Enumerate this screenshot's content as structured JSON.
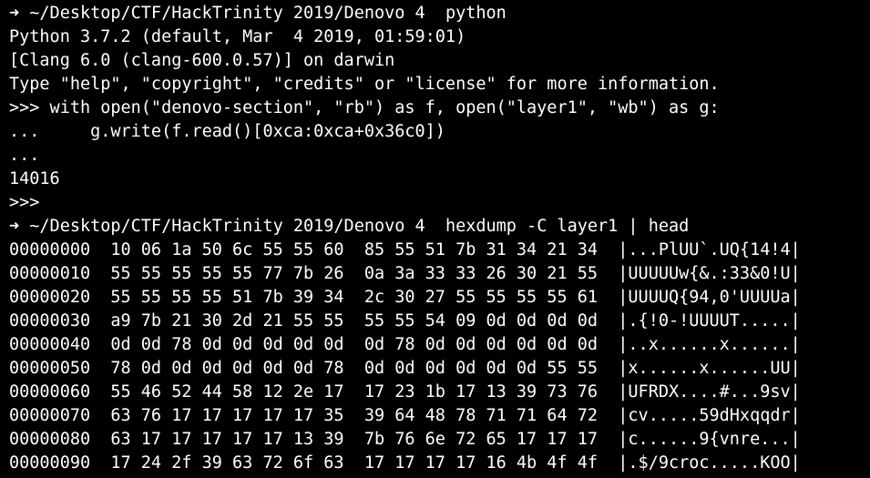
{
  "prompt_arrow": "➜",
  "lines": [
    {
      "type": "prompt",
      "cwd": " ~/Desktop/CTF/HackTrinity 2019/Denovo 4",
      "cmd": "  python"
    },
    {
      "type": "text",
      "text": "Python 3.7.2 (default, Mar  4 2019, 01:59:01)"
    },
    {
      "type": "text",
      "text": "[Clang 6.0 (clang-600.0.57)] on darwin"
    },
    {
      "type": "text",
      "text": "Type \"help\", \"copyright\", \"credits\" or \"license\" for more information."
    },
    {
      "type": "text",
      "text": ">>> with open(\"denovo-section\", \"rb\") as f, open(\"layer1\", \"wb\") as g:"
    },
    {
      "type": "text",
      "text": "...     g.write(f.read()[0xca:0xca+0x36c0])"
    },
    {
      "type": "text",
      "text": "..."
    },
    {
      "type": "text",
      "text": "14016"
    },
    {
      "type": "text",
      "text": ">>>"
    },
    {
      "type": "prompt",
      "cwd": " ~/Desktop/CTF/HackTrinity 2019/Denovo 4",
      "cmd": "  hexdump -C layer1 | head"
    },
    {
      "type": "text",
      "text": "00000000  10 06 1a 50 6c 55 55 60  85 55 51 7b 31 34 21 34  |...PlUU`.UQ{14!4|"
    },
    {
      "type": "text",
      "text": "00000010  55 55 55 55 55 77 7b 26  0a 3a 33 33 26 30 21 55  |UUUUUw{&.:33&0!U|"
    },
    {
      "type": "text",
      "text": "00000020  55 55 55 55 51 7b 39 34  2c 30 27 55 55 55 55 61  |UUUUQ{94,0'UUUUa|"
    },
    {
      "type": "text",
      "text": "00000030  a9 7b 21 30 2d 21 55 55  55 55 54 09 0d 0d 0d 0d  |.{!0-!UUUUT.....|"
    },
    {
      "type": "text",
      "text": "00000040  0d 0d 78 0d 0d 0d 0d 0d  0d 78 0d 0d 0d 0d 0d 0d  |..x......x......|"
    },
    {
      "type": "text",
      "text": "00000050  78 0d 0d 0d 0d 0d 0d 78  0d 0d 0d 0d 0d 0d 55 55  |x......x......UU|"
    },
    {
      "type": "text",
      "text": "00000060  55 46 52 44 58 12 2e 17  17 23 1b 17 13 39 73 76  |UFRDX....#...9sv|"
    },
    {
      "type": "text",
      "text": "00000070  63 76 17 17 17 17 17 35  39 64 48 78 71 71 64 72  |cv.....59dHxqqdr|"
    },
    {
      "type": "text",
      "text": "00000080  63 17 17 17 17 17 13 39  7b 76 6e 72 65 17 17 17  |c......9{vnre...|"
    },
    {
      "type": "text",
      "text": "00000090  17 24 2f 39 63 72 6f 63  17 17 17 17 16 4b 4f 4f  |.$/9croc.....KOO|"
    }
  ]
}
